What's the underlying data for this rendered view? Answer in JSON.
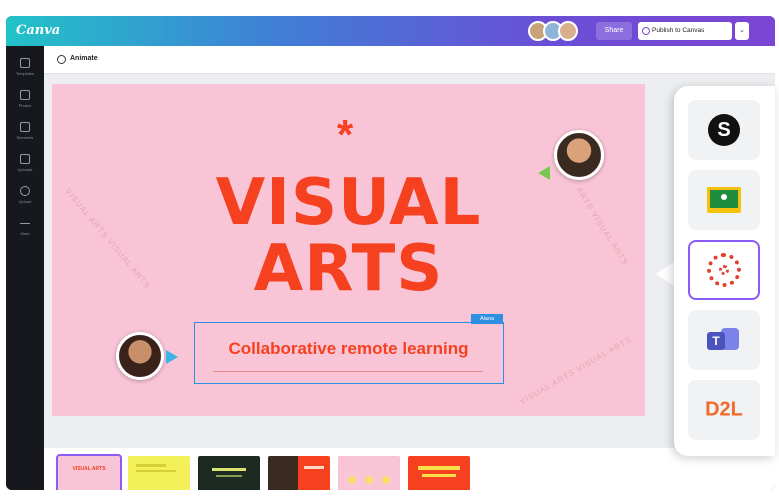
{
  "app": {
    "logo_text": "Canva",
    "brand_gradient": [
      "#22c3c8",
      "#7b45d4"
    ]
  },
  "header": {
    "share_label": "Share",
    "publish_label": "Publish to Canvas",
    "more_label": "⌄",
    "collaborators": [
      "#c9a27a",
      "#8fb4d8",
      "#d9b08c"
    ]
  },
  "toolbar": {
    "animate_label": "Animate"
  },
  "sidebar": {
    "items": [
      {
        "label": "Templates",
        "icon": "template-icon"
      },
      {
        "label": "Photos",
        "icon": "photos-icon"
      },
      {
        "label": "Elements",
        "icon": "elements-icon"
      },
      {
        "label": "Uploads",
        "icon": "uploads-icon"
      },
      {
        "label": "Upload",
        "icon": "upload-icon"
      },
      {
        "label": "More",
        "icon": "more-icon"
      }
    ]
  },
  "slide": {
    "asterisk": "*",
    "title_line1": "VISUAL",
    "title_line2": "ARTS",
    "subtitle": "Collaborative remote learning",
    "editor_tag": "Alana",
    "wave_left": "VISUAL ARTS VISUAL ARTS",
    "wave_right": "ARTS VISUAL ARTS",
    "wave_bottom": "VISUAL ARTS VISUAL ARTS",
    "bg_color": "#f8c4d6",
    "accent_color": "#f5411f"
  },
  "filmstrip": {
    "thumbnails": [
      {
        "label": "VISUAL ARTS",
        "bg": "#f8c4d6",
        "fg": "#f5411f",
        "active": true
      },
      {
        "label": "",
        "bg": "#f4f05a",
        "fg": "#333333",
        "active": false
      },
      {
        "label": "",
        "bg": "#1d2a22",
        "fg": "#d9e36b",
        "active": false
      },
      {
        "label": "",
        "bg": "#f5411f",
        "fg": "#ffffff",
        "active": false
      },
      {
        "label": "",
        "bg": "#f8c4d6",
        "fg": "#f5411f",
        "active": false
      },
      {
        "label": "",
        "bg": "#f5411f",
        "fg": "#f8e04a",
        "active": false
      }
    ]
  },
  "lms": {
    "items": [
      {
        "name": "Schoology",
        "icon": "schoology-icon",
        "selected": false
      },
      {
        "name": "Google Classroom",
        "icon": "google-classroom-icon",
        "selected": false
      },
      {
        "name": "Canvas",
        "icon": "canvas-lms-icon",
        "selected": true
      },
      {
        "name": "Microsoft Teams",
        "icon": "teams-icon",
        "selected": false
      },
      {
        "name": "D2L",
        "icon": "d2l-icon",
        "selected": false,
        "text": "D2L"
      }
    ]
  }
}
